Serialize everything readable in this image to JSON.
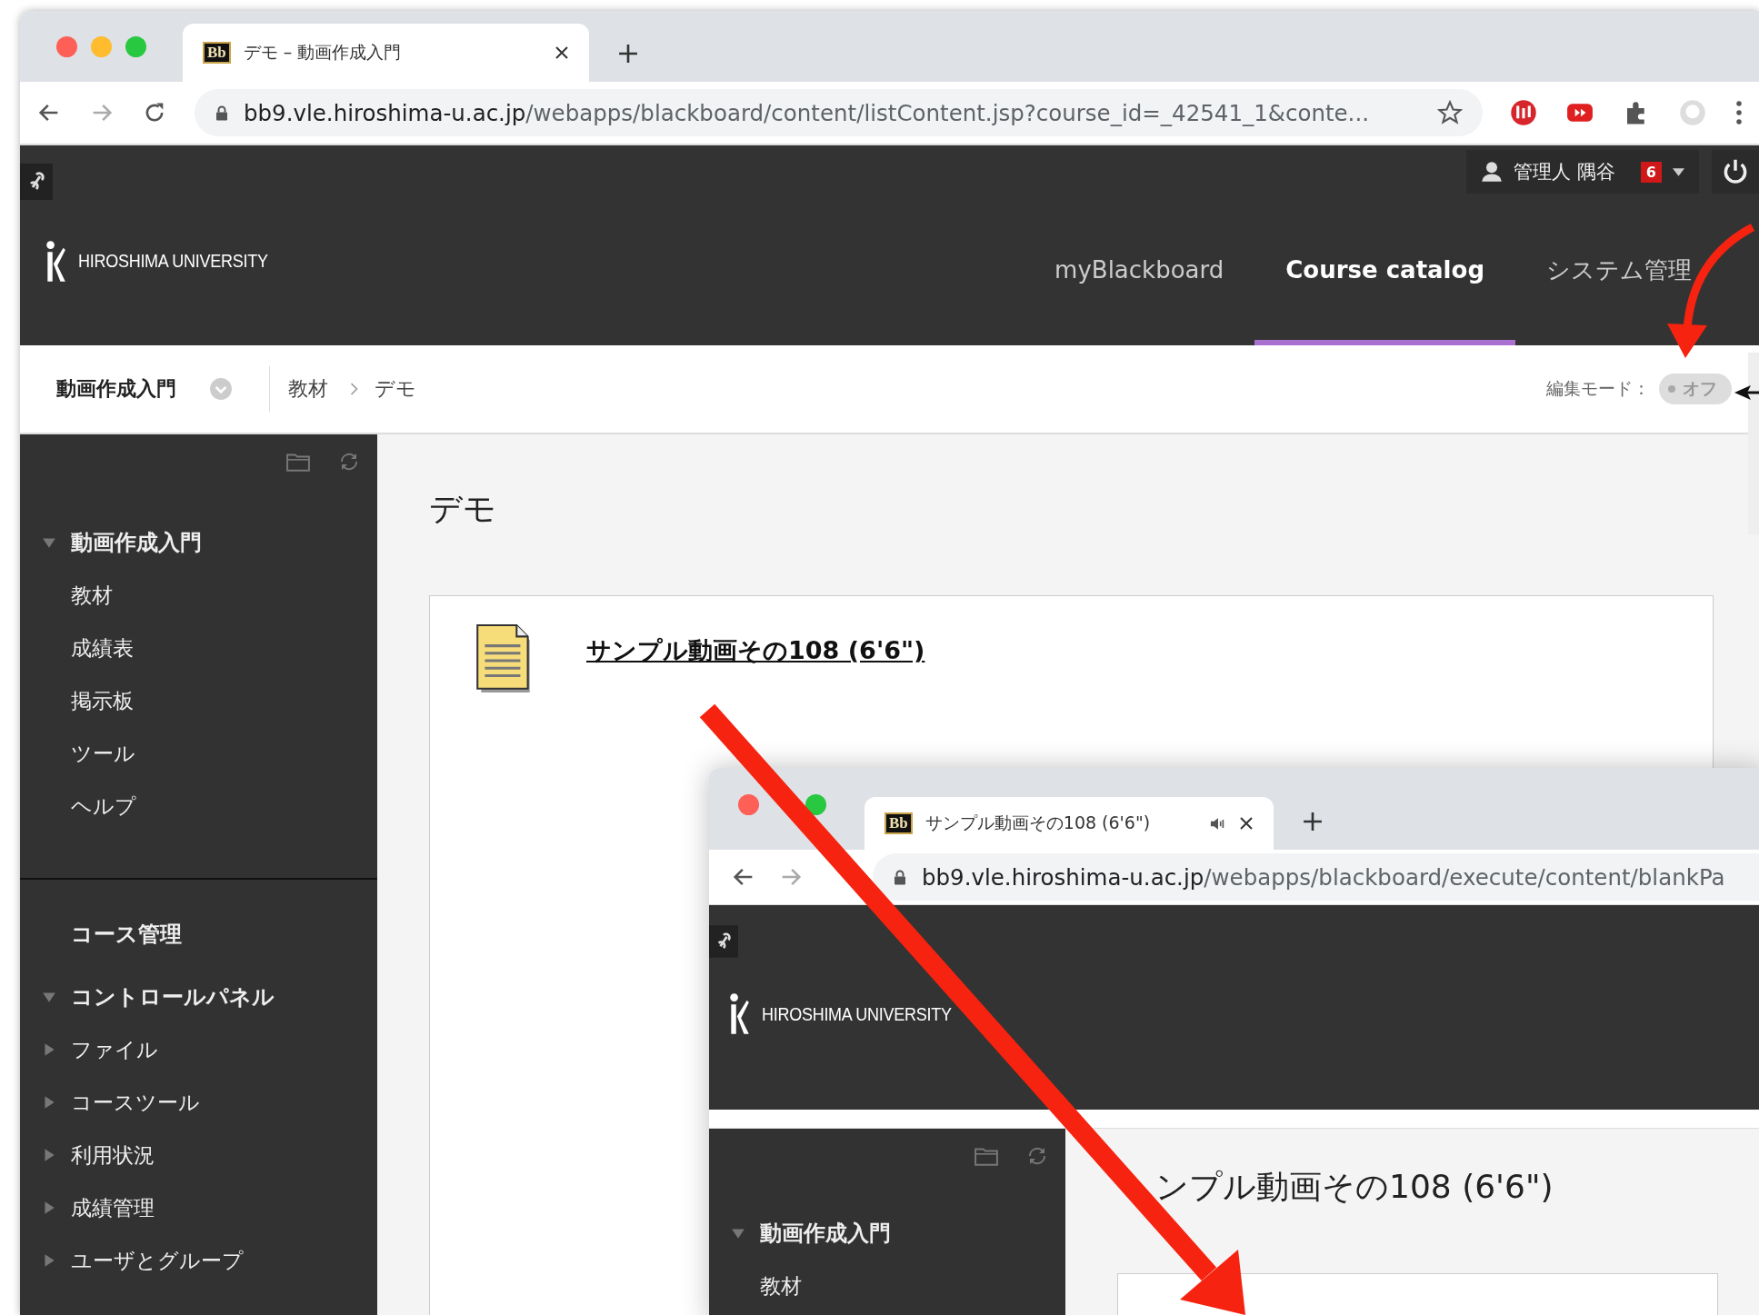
{
  "browser": {
    "tab": {
      "favicon": "Bb",
      "title": "デモ – 動画作成入門"
    },
    "url": {
      "host": "bb9.vle.hiroshima-u.ac.jp",
      "path": "/webapps/blackboard/content/listContent.jsp?course_id=_42541_1&conte..."
    }
  },
  "header": {
    "user": "管理人 隅谷",
    "badge": "6",
    "logo": "HIROSHIMA UNIVERSITY",
    "nav": [
      {
        "label": "myBlackboard",
        "selected": false
      },
      {
        "label": "Course catalog",
        "selected": true
      },
      {
        "label": "システム管理",
        "selected": false
      }
    ]
  },
  "breadcrumb": {
    "course": "動画作成入門",
    "items": [
      "教材",
      "デモ"
    ]
  },
  "edit_mode": {
    "label": "編集モード：",
    "value": "オフ",
    "on": false
  },
  "sidebar": {
    "course_menu": {
      "label": "動画作成入門",
      "expanded": true,
      "children": [
        {
          "label": "教材"
        },
        {
          "label": "成績表"
        },
        {
          "label": "掲示板"
        },
        {
          "label": "ツール"
        },
        {
          "label": "ヘルプ"
        }
      ]
    },
    "section_title": "コース管理",
    "control_panel": {
      "label": "コントロールパネル",
      "expanded": true,
      "children": [
        {
          "label": "ファイル",
          "expanded": false
        },
        {
          "label": "コースツール",
          "expanded": false
        },
        {
          "label": "利用状況",
          "expanded": false
        },
        {
          "label": "成績管理",
          "expanded": false
        },
        {
          "label": "ユーザとグループ",
          "expanded": false
        }
      ]
    }
  },
  "content": {
    "title": "デモ",
    "items": [
      {
        "title": "サンプル動画その108 (6'6\")"
      }
    ]
  },
  "popup": {
    "tab": {
      "favicon": "Bb",
      "title": "サンプル動画その108 (6'6\")",
      "audio": true
    },
    "url": {
      "host": "bb9.vle.hiroshima-u.ac.jp",
      "path": "/webapps/blackboard/execute/content/blankPa"
    },
    "logo": "HIROSHIMA UNIVERSITY",
    "sidebar": {
      "label": "動画作成入門",
      "expanded": true,
      "children": [
        {
          "label": "教材"
        }
      ]
    },
    "title": "ンプル動画その108 (6'6\")"
  }
}
